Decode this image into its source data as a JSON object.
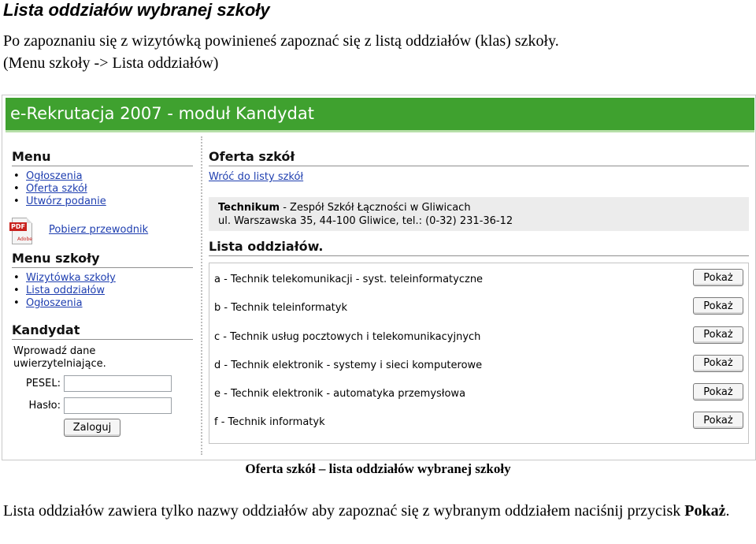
{
  "document": {
    "title": "Lista oddziałów wybranej szkoły",
    "intro_line1": "Po zapoznaniu się z wizytówką powinieneś zapoznać się z listą oddziałów (klas) szkoły.",
    "intro_line2": "(Menu szkoły -> Lista oddziałów)",
    "caption": "Oferta szkół – lista oddziałów wybranej szkoły",
    "outro_text": "Lista oddziałów zawiera tylko nazwy oddziałów aby zapoznać się z wybranym oddziałem naciśnij przycisk ",
    "outro_bold": "Pokaż",
    "outro_end": "."
  },
  "app": {
    "banner": "e-Rekrutacja 2007 - moduł Kandydat",
    "colors": {
      "banner": "#3fa12f",
      "link": "#1f3fb0",
      "panel": "#ececec"
    }
  },
  "sidebar": {
    "menu": {
      "title": "Menu",
      "items": [
        "Ogłoszenia",
        "Oferta szkół",
        "Utwórz podanie"
      ],
      "guide_icon": "pdf-icon",
      "guide_label": "Pobierz przewodnik"
    },
    "school_menu": {
      "title": "Menu szkoły",
      "items": [
        "Wizytówka szkoły",
        "Lista oddziałów",
        "Ogłoszenia"
      ]
    },
    "candidate": {
      "title": "Kandydat",
      "intro": "Wprowadź dane uwierzytelniające.",
      "pesel_label": "PESEL:",
      "pesel_value": "",
      "password_label": "Hasło:",
      "password_value": "",
      "login_button": "Zaloguj"
    }
  },
  "main": {
    "heading": "Oferta szkół",
    "back_link": "Wróć do listy szkół",
    "school": {
      "type": "Technikum",
      "name": " - Zespół Szkół Łączności w Gliwicach",
      "address": "ul. Warszawska 35, 44-100 Gliwice, tel.: (0-32) 231-36-12"
    },
    "list_heading": "Lista oddziałów.",
    "show_button": "Pokaż",
    "classes": [
      "a - Technik telekomunikacji - syst. teleinformatyczne",
      "b - Technik teleinformatyk",
      "c - Technik usług pocztowych i telekomunikacyjnych",
      "d - Technik elektronik - systemy i sieci komputerowe",
      "e - Technik elektronik - automatyka przemysłowa",
      "f - Technik informatyk"
    ]
  }
}
